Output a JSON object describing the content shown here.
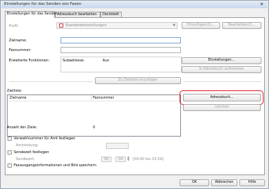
{
  "window": {
    "title": "Einstellungen für das Senden von Faxen"
  },
  "tabs": [
    "Einstellungen für das Senden",
    "Adressbuch bearbeiten",
    "Deckblatt"
  ],
  "profile": {
    "label": "Profil",
    "value": "Standardeinstellungen",
    "add_button": "Hinzufügen(1)...",
    "edit_button": "Bearbeiten(2)..."
  },
  "fields": {
    "name_label": "Zielname:",
    "fax_label": "Faxnummer:",
    "name_value": "",
    "fax_value": ""
  },
  "advanced": {
    "label": "Erweiterte Funktionen:",
    "sub_label": "Subadresse:",
    "sub_value": "Aus",
    "settings_button": "Einstellungen...",
    "addressbook_add_button": "In Adressbuch aufnehmen"
  },
  "add_to_list_button": "Zu Zielliste hinzufügen",
  "target_list": {
    "label": "Zielliste:",
    "columns": [
      "Zielname",
      "Faxnummer"
    ],
    "rows": []
  },
  "addressbook_button": "Adressbuch...",
  "delete_button": "Löschen",
  "count": {
    "label": "Anzahl der Ziele:",
    "value": "0"
  },
  "prefix": {
    "label": "Vorwahlnummer für Amt festlegen",
    "sub_label": "Amtsholung:",
    "checked": false
  },
  "sendtime": {
    "label": "Sendezeit festlegen",
    "sub_label": "Sendezeit:",
    "hour": "00",
    "minute": "00",
    "range": "[00:00 bis 23:59]",
    "checked": false
  },
  "save_info": {
    "label": "Faxausgangsinformationen und Bild speichern",
    "checked": false
  },
  "footer": {
    "ok": "OK",
    "cancel": "Abbrechen",
    "help": "Hilfe"
  },
  "colors": {
    "highlight": "#e0141c"
  }
}
